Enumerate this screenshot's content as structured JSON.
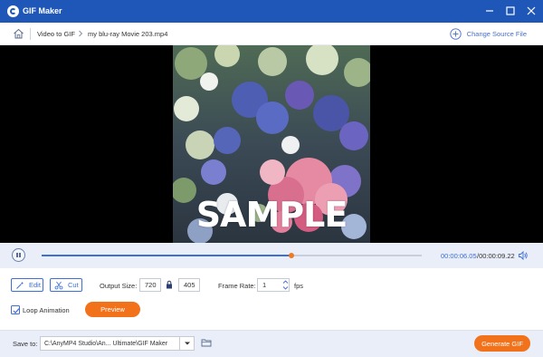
{
  "window": {
    "title": "GIF Maker",
    "logo_icon": "app-logo-icon",
    "controls": [
      "minimize-icon",
      "maximize-icon",
      "close-icon"
    ]
  },
  "nav": {
    "home_icon": "home-icon",
    "breadcrumb": [
      "Video to GIF",
      "my blu-ray Movie 203.mp4"
    ],
    "change_source_label": "Change Source File"
  },
  "video": {
    "watermark": "SAMPLE"
  },
  "playback": {
    "current_time": "00:00:06.05",
    "total_time": "/00:00:09.22",
    "progress": 0.656,
    "state": "playing"
  },
  "settings": {
    "edit_label": "Edit",
    "cut_label": "Cut",
    "output_size_label": "Output Size:",
    "width": "720",
    "height": "405",
    "frame_rate_label": "Frame Rate:",
    "frame_rate": "1",
    "fps_label": "fps",
    "loop_label": "Loop Animation",
    "loop_checked": true,
    "preview_label": "Preview"
  },
  "footer": {
    "save_to_label": "Save to:",
    "save_path": "C:\\AnyMP4 Studio\\An... Ultimate\\GIF Maker",
    "generate_label": "Generate GIF"
  },
  "colors": {
    "titlebar": "#1f57b8",
    "accent": "#3d6fd6",
    "orange": "#f2721c",
    "panel": "#e9eef8"
  }
}
